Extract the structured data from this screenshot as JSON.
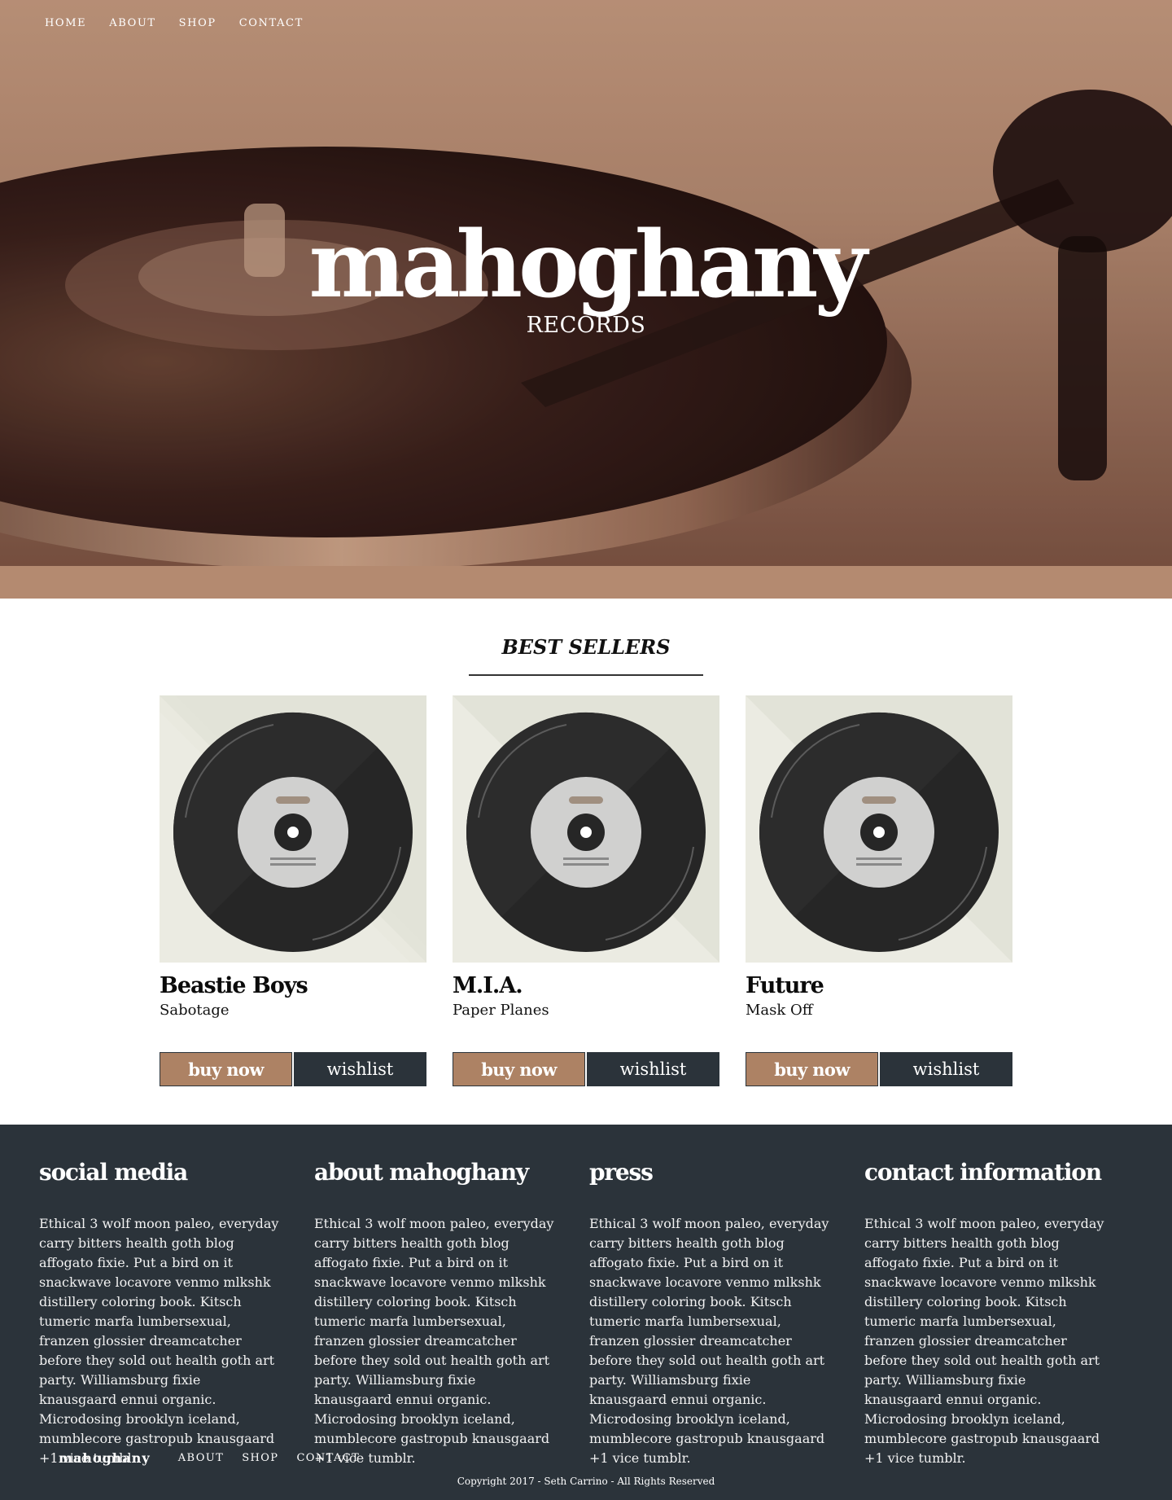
{
  "nav": {
    "items": [
      "HOME",
      "ABOUT",
      "SHOP",
      "CONTACT"
    ]
  },
  "hero": {
    "title": "mahoghany",
    "subtitle": "RECORDS"
  },
  "best_sellers": {
    "heading": "BEST SELLERS",
    "products": [
      {
        "artist": "Beastie Boys",
        "track": "Sabotage",
        "buy_label": "buy now",
        "wishlist_label": "wishlist"
      },
      {
        "artist": "M.I.A.",
        "track": "Paper Planes",
        "buy_label": "buy now",
        "wishlist_label": "wishlist"
      },
      {
        "artist": "Future",
        "track": "Mask Off",
        "buy_label": "buy now",
        "wishlist_label": "wishlist"
      }
    ]
  },
  "footer": {
    "columns": [
      {
        "title": "social media",
        "body": "Ethical 3 wolf moon paleo, everyday carry bitters health goth blog affogato fixie. Put a bird on it snackwave locavore venmo mlkshk distillery coloring book. Kitsch tumeric marfa lumbersexual, franzen glossier dreamcatcher before they sold out health goth art party. Williamsburg fixie knausgaard ennui organic. Microdosing brooklyn iceland, mumblecore gastropub knausgaard +1 vice tumblr."
      },
      {
        "title": "about mahoghany",
        "body": "Ethical 3 wolf moon paleo, everyday carry bitters health goth blog affogato fixie. Put a bird on it snackwave locavore venmo mlkshk distillery coloring book. Kitsch tumeric marfa lumbersexual, franzen glossier dreamcatcher before they sold out health goth art party. Williamsburg fixie knausgaard ennui organic. Microdosing brooklyn iceland, mumblecore gastropub knausgaard +1 vice tumblr."
      },
      {
        "title": "press",
        "body": "Ethical 3 wolf moon paleo, everyday carry bitters health goth blog affogato fixie. Put a bird on it snackwave locavore venmo mlkshk distillery coloring book. Kitsch tumeric marfa lumbersexual, franzen glossier dreamcatcher before they sold out health goth art party. Williamsburg fixie knausgaard ennui organic. Microdosing brooklyn iceland, mumblecore gastropub knausgaard +1 vice tumblr."
      },
      {
        "title": "contact information",
        "body": "Ethical 3 wolf moon paleo, everyday carry bitters health goth blog affogato fixie. Put a bird on it snackwave locavore venmo mlkshk distillery coloring book. Kitsch tumeric marfa lumbersexual, franzen glossier dreamcatcher before they sold out health goth art party. Williamsburg fixie knausgaard ennui organic. Microdosing brooklyn iceland, mumblecore gastropub knausgaard +1 vice tumblr."
      }
    ],
    "brand": "mahoghany",
    "nav": [
      "ABOUT",
      "SHOP",
      "CONTACT"
    ],
    "copyright": "Copyright 2017 - Seth Carrino - All Rights Reserved"
  },
  "colors": {
    "accent_buy": "#ad8264",
    "dark": "#2b333a",
    "cover_bg": "#e2e3d8"
  },
  "icons": {
    "cover_art": "vinyl-record-icon"
  }
}
